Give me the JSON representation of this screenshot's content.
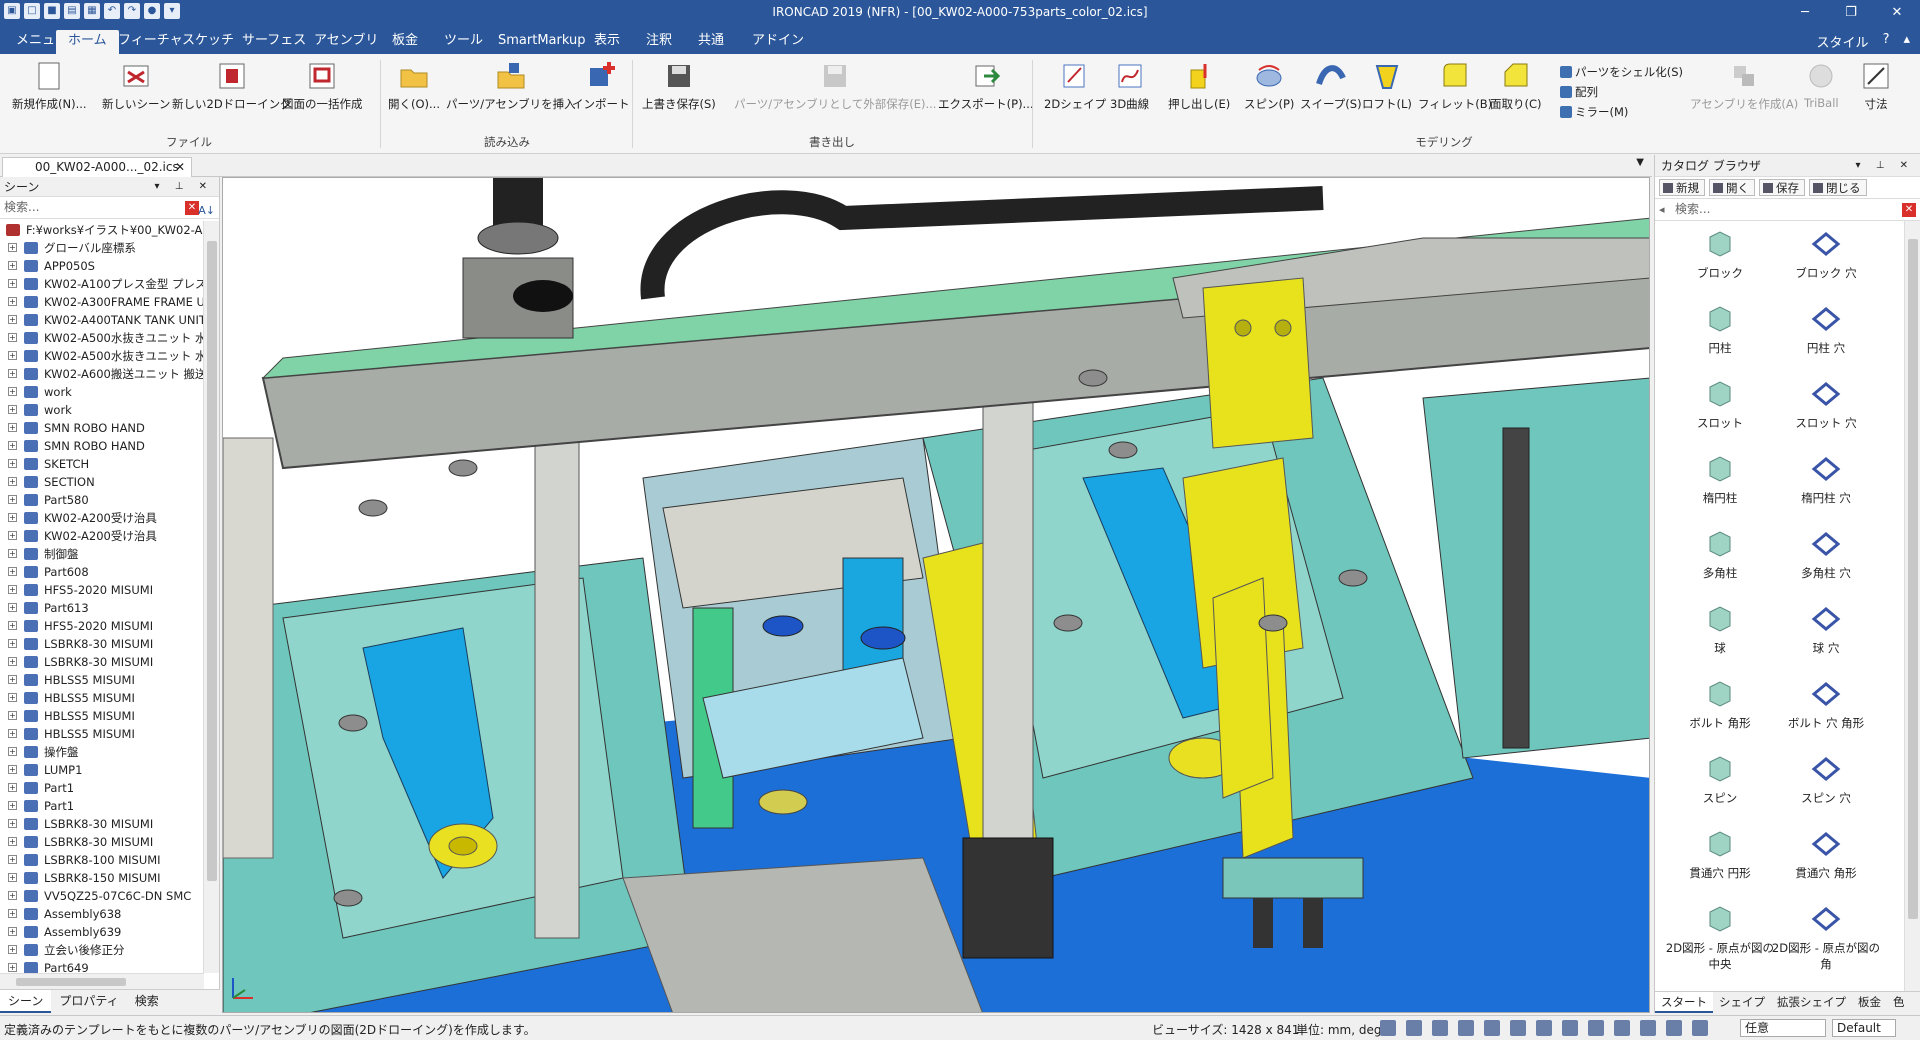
{
  "window": {
    "title": "IRONCAD 2019 (NFR) - [00_KW02-A000-753parts_color_02.ics]",
    "controls": [
      "─",
      "❐",
      "✕"
    ]
  },
  "menu": {
    "tabs": [
      "メニュー",
      "ホーム",
      "フィーチャ",
      "スケッチ",
      "サーフェス",
      "アセンブリ",
      "板金",
      "ツール",
      "SmartMarkup",
      "表示",
      "注釈",
      "共通",
      "アドイン"
    ],
    "active_index": 1,
    "style_label": "スタイル"
  },
  "ribbon": {
    "groups": {
      "file": {
        "label": "ファイル",
        "buttons": [
          "新規作成(N)...",
          "新しいシーン",
          "新しい2Dドローイング",
          "図面の一括作成"
        ]
      },
      "import": {
        "label": "読み込み",
        "buttons": [
          "開く(O)...",
          "パーツ/アセンブリを挿入",
          "インポート"
        ]
      },
      "export": {
        "label": "書き出し",
        "buttons": [
          "上書き保存(S)",
          "パーツ/アセンブリとして外部保存(E)...",
          "エクスポート(P)..."
        ]
      },
      "modeling": {
        "label": "モデリング",
        "buttons": [
          "2Dシェイプ",
          "3D曲線",
          "押し出し(E)",
          "スピン(P)",
          "スイープ(S)",
          "ロフト(L)",
          "フィレット(B)",
          "面取り(C)"
        ],
        "small_buttons": [
          "パーツをシェル化(S)",
          "配列",
          "ミラー(M)"
        ]
      },
      "extra": {
        "buttons": [
          "アセンブリを作成(A)",
          "TriBall",
          "寸法"
        ]
      }
    }
  },
  "document_tab": {
    "label": "00_KW02-A000..._02.ics",
    "close": "✕"
  },
  "scene_panel": {
    "title": "シーン",
    "search_placeholder": "検索...",
    "root": "F:¥works¥イラスト¥00_KW02-A000-",
    "items": [
      "グローバル座標系",
      "APP050S",
      "KW02-A100プレス金型 プレス金",
      "KW02-A300FRAME FRAME UN",
      "KW02-A400TANK TANK UNIT",
      "KW02-A500水抜きユニット 水抜",
      "KW02-A500水抜きユニット 水抜",
      "KW02-A600搬送ユニット 搬送ユ",
      "work",
      "work",
      "SMN ROBO HAND",
      "SMN ROBO HAND",
      "SKETCH",
      "SECTION",
      "Part580",
      "KW02-A200受け治具",
      "KW02-A200受け治具",
      "制御盤",
      "Part608",
      "HFS5-2020 MISUMI",
      "Part613",
      "HFS5-2020 MISUMI",
      "LSBRK8-30 MISUMI",
      "LSBRK8-30 MISUMI",
      "HBLSS5 MISUMI",
      "HBLSS5 MISUMI",
      "HBLSS5 MISUMI",
      "HBLSS5 MISUMI",
      "操作盤",
      "LUMP1",
      "Part1",
      "Part1",
      "LSBRK8-30 MISUMI",
      "LSBRK8-30 MISUMI",
      "LSBRK8-100 MISUMI",
      "LSBRK8-150 MISUMI",
      "VV5QZ25-07C6C-DN SMC",
      "Assembly638",
      "Assembly639",
      "立会い後修正分",
      "Part649"
    ],
    "tabs": [
      "シーン",
      "プロパティ",
      "検索"
    ]
  },
  "catalog_panel": {
    "title": "カタログ ブラウザ",
    "toolbar": [
      "新規",
      "開く",
      "保存",
      "閉じる"
    ],
    "search_placeholder": "検索...",
    "items": [
      "ブロック",
      "ブロック 穴",
      "円柱",
      "円柱 穴",
      "スロット",
      "スロット 穴",
      "楕円柱",
      "楕円柱 穴",
      "多角柱",
      "多角柱 穴",
      "球",
      "球 穴",
      "ボルト 角形",
      "ボルト 穴 角形",
      "スピン",
      "スピン 穴",
      "貫通穴 円形",
      "貫通穴 角形",
      "2D図形 - 原点が図の中央",
      "2D図形 - 原点が図の角"
    ],
    "tabs": [
      "スタート",
      "シェイプ",
      "拡張シェイプ",
      "板金",
      "色"
    ]
  },
  "status": {
    "message": "定義済みのテンプレートをもとに複数のパーツ/アセンブリの図面(2Dドローイング)を作成します。",
    "view_size": "ビューサイズ: 1428 x 841",
    "units": "単位: mm, deg",
    "select1": "任意",
    "select2": "Default"
  },
  "colors": {
    "brand": "#2b579a",
    "model_teal": "#5fbfb4",
    "model_cyan": "#1aa3e0",
    "model_yellow": "#e7e21c",
    "model_gray": "#a8aca6",
    "model_blue": "#1a6fd6",
    "model_green": "#43c98a"
  }
}
